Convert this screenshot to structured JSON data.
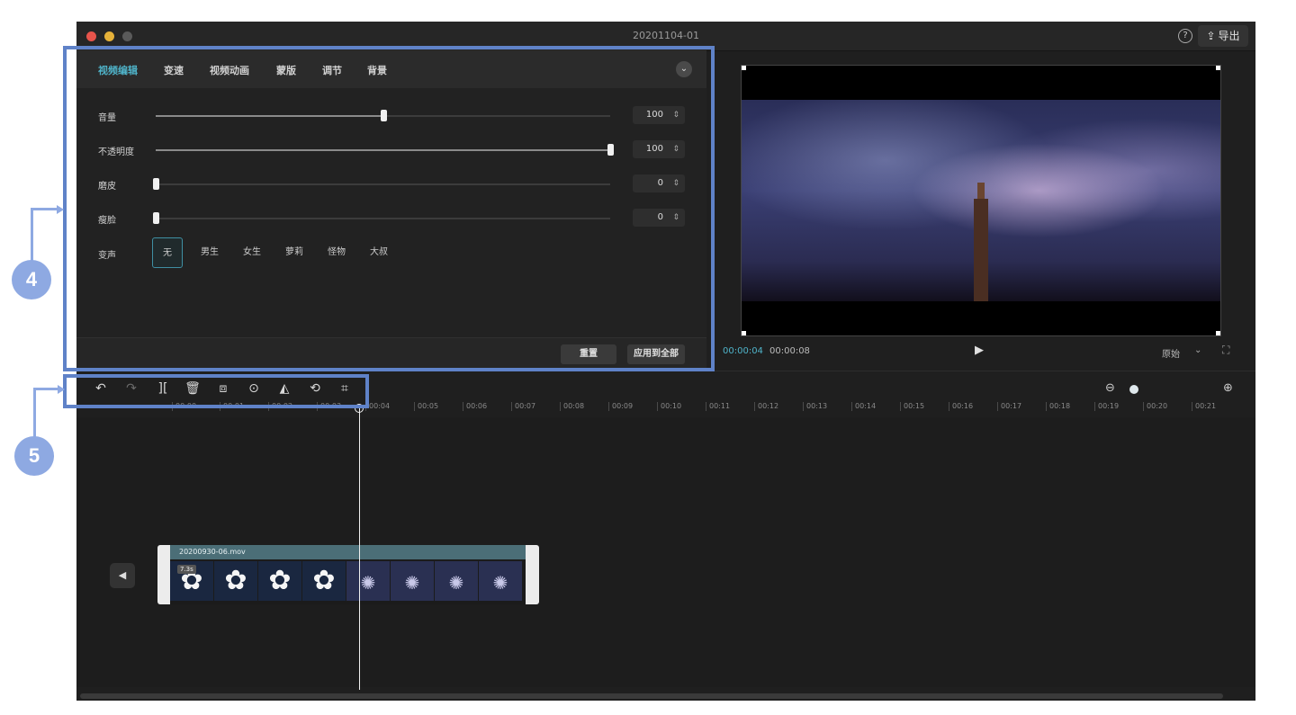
{
  "window": {
    "title": "20201104-01",
    "help_icon": "?",
    "export_label": "导出",
    "export_icon": "share-icon"
  },
  "edit_panel": {
    "tabs": [
      "视频编辑",
      "变速",
      "视频动画",
      "蒙版",
      "调节",
      "背景"
    ],
    "active_tab": "视频编辑",
    "sliders": [
      {
        "label": "音量",
        "value": "100",
        "fraction": 0.5
      },
      {
        "label": "不透明度",
        "value": "100",
        "fraction": 1.0
      },
      {
        "label": "磨皮",
        "value": "0",
        "fraction": 0.0
      },
      {
        "label": "瘦脸",
        "value": "0",
        "fraction": 0.0
      }
    ],
    "voice_label": "变声",
    "voice_options": [
      "无",
      "男生",
      "女生",
      "萝莉",
      "怪物",
      "大叔"
    ],
    "voice_selected": "无",
    "reset_label": "重置",
    "apply_all_label": "应用到全部"
  },
  "player": {
    "current_time": "00:00:04",
    "total_time": "00:00:08",
    "ratio_label": "原始"
  },
  "timeline": {
    "ruler": [
      "00:00",
      "00:01",
      "00:02",
      "00:03",
      "00:04",
      "00:05",
      "00:06",
      "00:07",
      "00:08",
      "00:09",
      "00:10",
      "00:11",
      "00:12",
      "00:13",
      "00:14",
      "00:15",
      "00:16",
      "00:17",
      "00:18",
      "00:19",
      "00:20",
      "00:21"
    ],
    "clip": {
      "name": "20200930-06.mov",
      "duration": "7.3s"
    }
  },
  "annotations": {
    "callout_4": "4",
    "callout_5": "5"
  },
  "colors": {
    "accent": "#4fb3c9",
    "annotation": "#5f82c8",
    "annotation_circle": "#8ea9e2"
  }
}
